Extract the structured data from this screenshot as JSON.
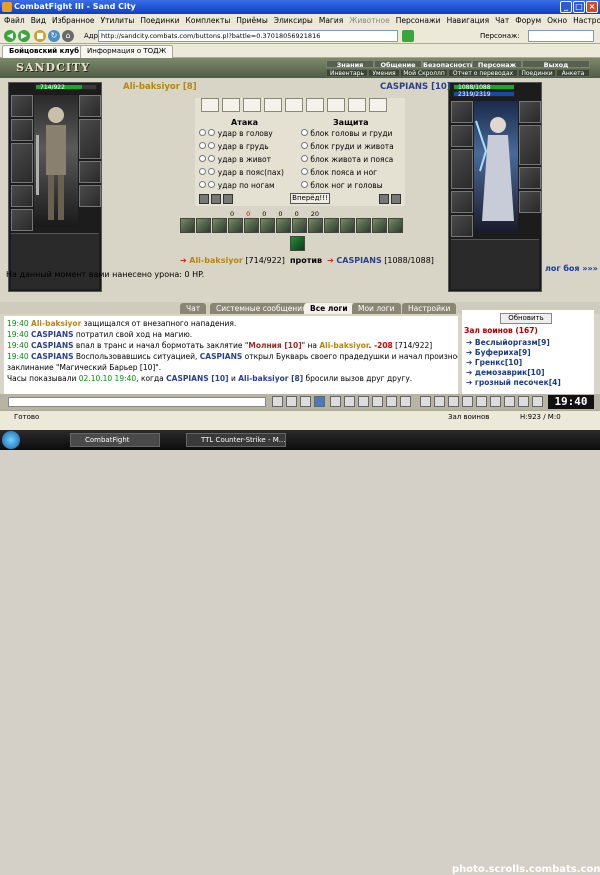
{
  "window": {
    "title": "CombatFight III - Sand City"
  },
  "menu": [
    "Файл",
    "Вид",
    "Избранное",
    "Утилиты",
    "Поединки",
    "Комплекты",
    "Приёмы",
    "Эликсиры",
    "Магия",
    "Животное",
    "Персонажи",
    "Навигация",
    "Чат",
    "Форум",
    "Окно",
    "Настройки",
    "?"
  ],
  "toolbar": {
    "address_label": "Адрес:",
    "address_value": "http://sandcity.combats.com/buttons.pl?battle=0.37018056921816",
    "person_label": "Персонаж:"
  },
  "browser_tabs": [
    "Бойцовский клуб",
    "Информация о ТОДЖ"
  ],
  "game": {
    "logo": "SANDCITY",
    "nav_top": [
      "Знания",
      "Общение",
      "Безопасность",
      "Персонаж",
      "Выход"
    ],
    "nav_bottom": [
      "Инвентарь",
      "Умения",
      "Мой Скроллп",
      "Отчет о переводах",
      "Поединки",
      "Анкета"
    ],
    "left_fighter": {
      "hp": "714/922",
      "hp_fraction": 0.774,
      "name": "Ali-baksiyor [8]",
      "badge": "i"
    },
    "right_fighter": {
      "hp": "1088/1088",
      "mana": "2319/2319",
      "hp_fraction": 1.0,
      "name": "CASPIANS [10]",
      "badge": "i"
    },
    "attack": {
      "title": "Атака",
      "options": [
        "удар в голову",
        "удар в грудь",
        "удар в живот",
        "удар в пояс(пах)",
        "удар по ногам"
      ]
    },
    "defense": {
      "title": "Защита",
      "options": [
        "блок головы и груди",
        "блок груди и живота",
        "блок живота и пояса",
        "блок пояса и ног",
        "блок ног и головы"
      ]
    },
    "forward_button": "Вперёд!!!",
    "stats": [
      "0",
      "0",
      "0",
      "0",
      "0",
      "20"
    ],
    "vs": {
      "left_name": "Ali-baksiyor",
      "left_hp": "[714/922]",
      "middle": "против",
      "right_name": "CASPIANS",
      "right_hp": "[1088/1088]"
    },
    "damage_text": "На данный момент вами нанесено урона: 0 HP.",
    "log_link": "лог боя »»»",
    "log_tabs": [
      "Чат",
      "Системные сообщения",
      "Все логи",
      "Мои логи",
      "Настройки"
    ],
    "log": [
      {
        "time": "19:40",
        "a": "Ali-baksiyor",
        "rest": " защищался от внезапного нападения."
      },
      {
        "time": "19:40",
        "a": "CASPIANS",
        "rest": " потратил свой ход на магию."
      },
      {
        "time": "19:40",
        "a": "CASPIANS",
        "rest": " впал в транс и начал бормотать заклятие \"",
        "spell": "Молния [10]",
        "rest2": "\" на ",
        "b": "Ali-baksiyor",
        "dmg": ". -208",
        "tail": " [714/922]"
      },
      {
        "time": "19:40",
        "a": "CASPIANS",
        "rest": " Воспользовавшись ситуацией, ",
        "b": "CASPIANS",
        "rest2": " открыл Букварь своего прадедушки и начал произносить"
      },
      {
        "text": "заклинание \"Магический Барьер [10]\"."
      },
      {
        "pre": "Часы показывали ",
        "date": "02.10.10 19:40",
        "mid": ", когда ",
        "a": "CASPIANS [10]",
        "and": " и ",
        "b": "Ali-baksiyor [8]",
        "post": " бросили вызов друг другу."
      }
    ],
    "room": {
      "refresh": "Обновить",
      "title": "Зал воинов (167)",
      "players": [
        "Веслыйоргазм[9]",
        "Буферихa[9]",
        "Гренкс[10]",
        "демозаврик[10]",
        "грозный песочек[4]"
      ]
    }
  },
  "chat_input": "",
  "clock": "19:40",
  "status": {
    "left": "Готово",
    "middle": "Зал воинов",
    "right": "H:923 / M:0"
  },
  "taskbar": {
    "items": [
      "CombatFight",
      "TTL Counter-Strike - M..."
    ],
    "watermark": "photo.scrolls.combats.com"
  }
}
